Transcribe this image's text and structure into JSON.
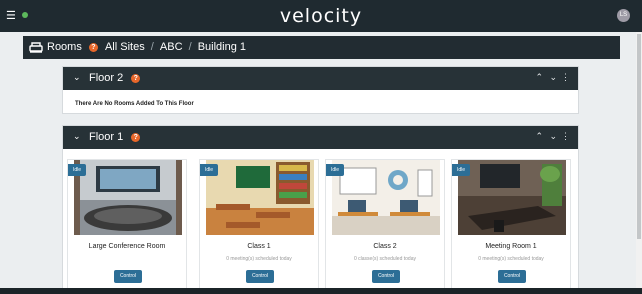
{
  "topbar": {
    "brand": "velocity",
    "avatar": "LS",
    "menu_icon": "hamburger-icon",
    "status_color": "#5cb85c"
  },
  "breadcrumb": {
    "section": "Rooms",
    "items": [
      "All Sites",
      "ABC",
      "Building 1"
    ],
    "separator": "/",
    "help": "?"
  },
  "floors": [
    {
      "name": "Floor 2",
      "empty_message": "There Are No Rooms Added To This Floor"
    },
    {
      "name": "Floor 1",
      "rooms": [
        {
          "status": "Idle",
          "name": "Large Conference Room",
          "meta": "",
          "control": "Control"
        },
        {
          "status": "Idle",
          "name": "Class 1",
          "meta": "0 meeting(s) scheduled today",
          "control": "Control"
        },
        {
          "status": "Idle",
          "name": "Class 2",
          "meta": "0 classe(s) scheduled today",
          "control": "Control"
        },
        {
          "status": "Idle",
          "name": "Meeting Room 1",
          "meta": "0 meeting(s) scheduled today",
          "control": "Control"
        }
      ]
    }
  ],
  "colors": {
    "accent": "#2c6e96",
    "help": "#e8672a",
    "header": "#273237"
  }
}
